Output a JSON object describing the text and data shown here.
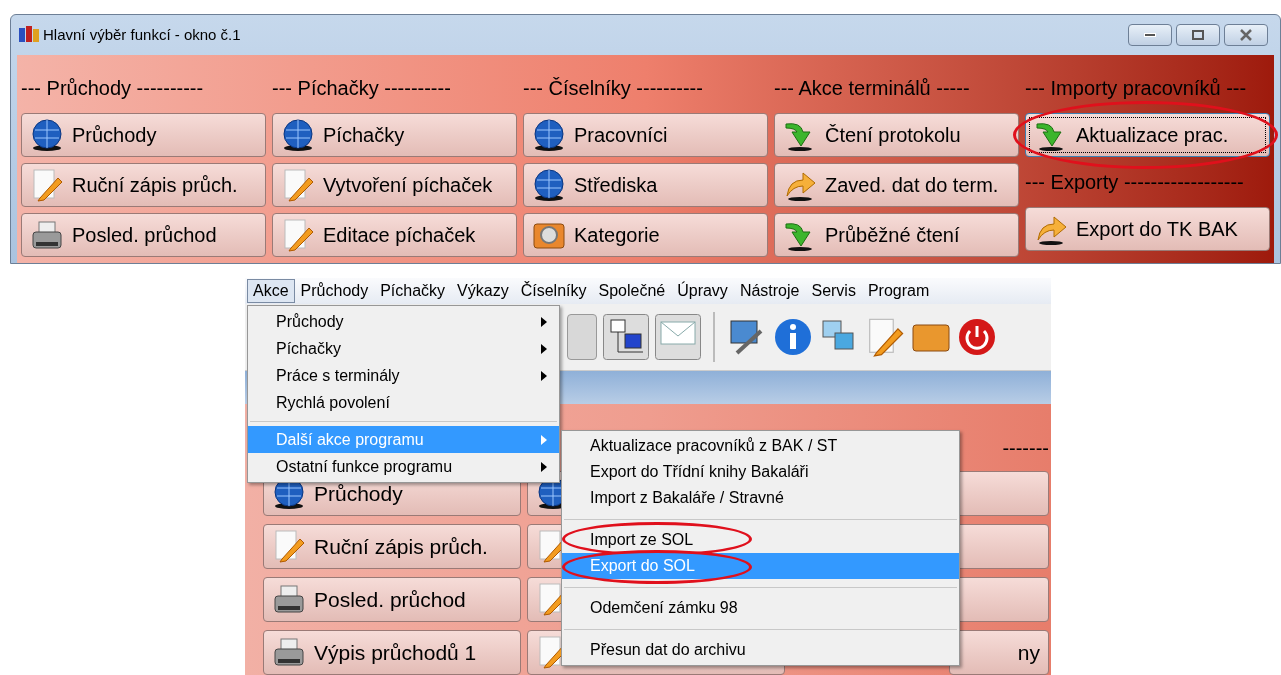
{
  "window": {
    "title": "Hlavní výběr funkcí - okno č.1"
  },
  "columns": [
    {
      "items": [
        {
          "kind": "heading",
          "label": "--- Průchody ----------"
        },
        {
          "kind": "button",
          "label": "Průchody",
          "focused": false,
          "circled": false
        },
        {
          "kind": "button",
          "label": "Ruční zápis průch.",
          "focused": false,
          "circled": false
        },
        {
          "kind": "button",
          "label": "Posled. průchod",
          "focused": false,
          "circled": false
        }
      ]
    },
    {
      "items": [
        {
          "kind": "heading",
          "label": "--- Píchačky ----------"
        },
        {
          "kind": "button",
          "label": "Píchačky",
          "focused": false,
          "circled": false
        },
        {
          "kind": "button",
          "label": "Vytvoření píchaček",
          "focused": false,
          "circled": false
        },
        {
          "kind": "button",
          "label": "Editace píchaček",
          "focused": false,
          "circled": false
        }
      ]
    },
    {
      "items": [
        {
          "kind": "heading",
          "label": "--- Číselníky ----------"
        },
        {
          "kind": "button",
          "label": "Pracovníci",
          "focused": false,
          "circled": false
        },
        {
          "kind": "button",
          "label": "Střediska",
          "focused": false,
          "circled": false
        },
        {
          "kind": "button",
          "label": "Kategorie",
          "focused": false,
          "circled": false
        }
      ]
    },
    {
      "items": [
        {
          "kind": "heading",
          "label": "--- Akce terminálů -----"
        },
        {
          "kind": "button",
          "label": "Čtení protokolu",
          "focused": false,
          "circled": false
        },
        {
          "kind": "button",
          "label": "Zaved. dat do term.",
          "focused": false,
          "circled": false
        },
        {
          "kind": "button",
          "label": "Průběžné čtení",
          "focused": false,
          "circled": false
        }
      ]
    },
    {
      "items": [
        {
          "kind": "heading",
          "label": "--- Importy pracovníků ---"
        },
        {
          "kind": "button",
          "label": "Aktualizace prac.",
          "focused": true,
          "circled": true
        },
        {
          "kind": "heading",
          "label": "--- Exporty ------------------"
        },
        {
          "kind": "button",
          "label": "Export do TK BAK",
          "focused": false,
          "circled": false
        }
      ]
    }
  ],
  "app": {
    "menubar": [
      {
        "label": "Akce",
        "selected": true
      },
      {
        "label": "Průchody",
        "selected": false
      },
      {
        "label": "Píchačky",
        "selected": false
      },
      {
        "label": "Výkazy",
        "selected": false
      },
      {
        "label": "Číselníky",
        "selected": false
      },
      {
        "label": "Společné",
        "selected": false
      },
      {
        "label": "Úpravy",
        "selected": false
      },
      {
        "label": "Nástroje",
        "selected": false
      },
      {
        "label": "Servis",
        "selected": false
      },
      {
        "label": "Program",
        "selected": false
      }
    ],
    "background_buttons": [
      {
        "label": "Průchody"
      },
      {
        "label": "Ruční zápis průch."
      },
      {
        "label": "Posled. průchod"
      },
      {
        "label": "Výpis průchodů 1"
      }
    ],
    "right_heading": "-------",
    "right_button_text": "ny",
    "menu": [
      {
        "kind": "item",
        "label": "Průchody",
        "submenu": true,
        "selected": false
      },
      {
        "kind": "item",
        "label": "Píchačky",
        "submenu": true,
        "selected": false
      },
      {
        "kind": "item",
        "label": "Práce s terminály",
        "submenu": true,
        "selected": false
      },
      {
        "kind": "item",
        "label": "Rychlá povolení",
        "submenu": false,
        "selected": false
      },
      {
        "kind": "separator"
      },
      {
        "kind": "item",
        "label": "Další akce programu",
        "submenu": true,
        "selected": true
      },
      {
        "kind": "item",
        "label": "Ostatní funkce programu",
        "submenu": true,
        "selected": false
      }
    ],
    "submenu": [
      {
        "kind": "item",
        "label": "Aktualizace pracovníků z BAK / ST",
        "selected": false,
        "circled": false
      },
      {
        "kind": "item",
        "label": "Export do Třídní knihy Bakaláři",
        "selected": false,
        "circled": false
      },
      {
        "kind": "item",
        "label": "Import z Bakaláře / Stravné",
        "selected": false,
        "circled": false
      },
      {
        "kind": "separator"
      },
      {
        "kind": "item",
        "label": "Import ze SOL",
        "selected": false,
        "circled": true
      },
      {
        "kind": "item",
        "label": "Export do SOL",
        "selected": true,
        "circled": true
      },
      {
        "kind": "separator"
      },
      {
        "kind": "item",
        "label": "Odemčení zámku 98",
        "selected": false,
        "circled": false
      },
      {
        "kind": "separator"
      },
      {
        "kind": "item",
        "label": "Přesun dat do archivu",
        "selected": false,
        "circled": false
      }
    ]
  }
}
